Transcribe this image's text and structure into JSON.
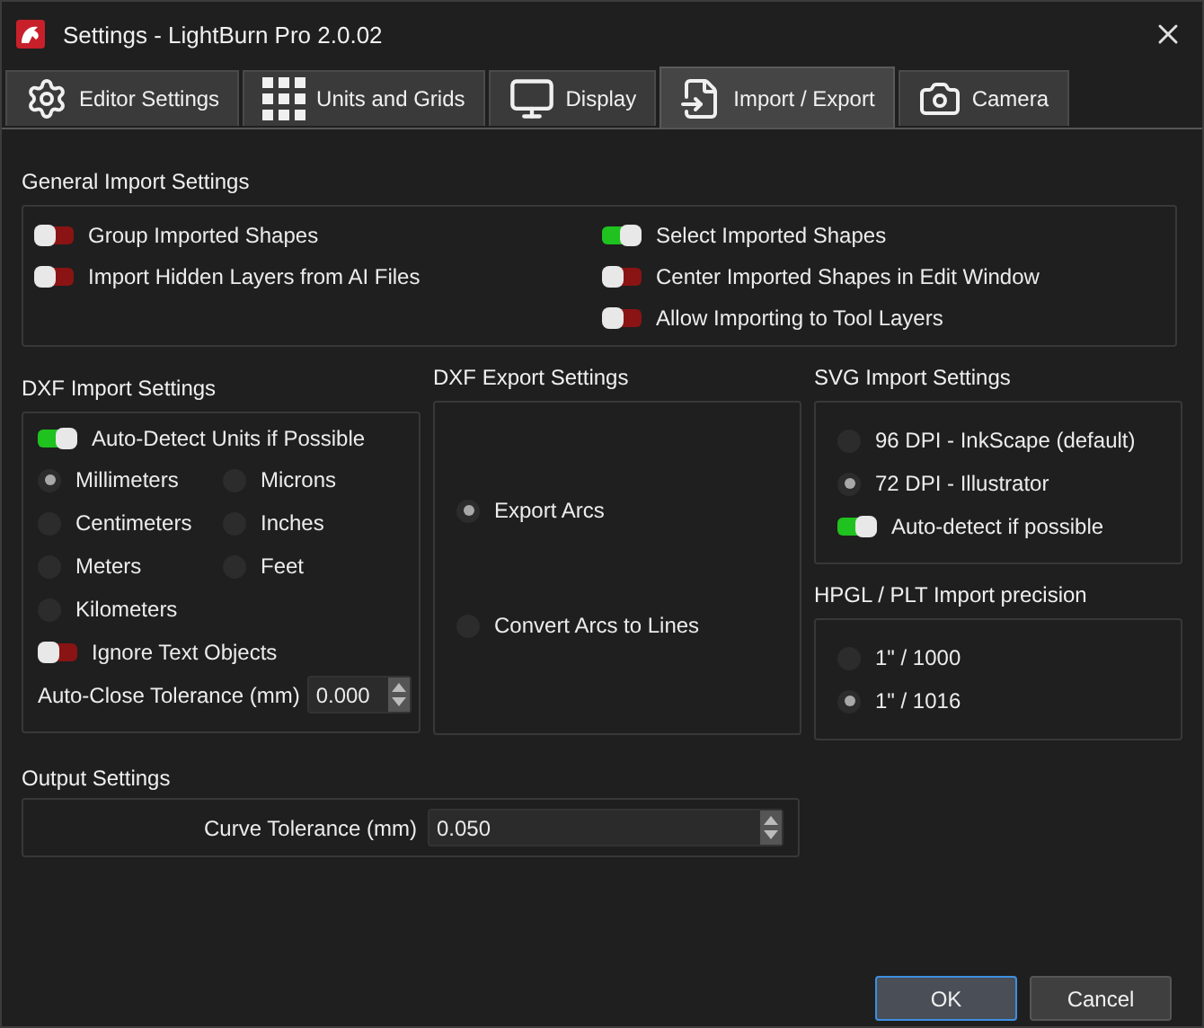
{
  "window": {
    "title": "Settings - LightBurn Pro 2.0.02"
  },
  "tabs": [
    {
      "label": "Editor Settings",
      "selected": false
    },
    {
      "label": "Units and Grids",
      "selected": false
    },
    {
      "label": "Display",
      "selected": false
    },
    {
      "label": "Import / Export",
      "selected": true
    },
    {
      "label": "Camera",
      "selected": false
    }
  ],
  "general_import": {
    "title": "General Import Settings",
    "left": [
      {
        "label": "Group Imported Shapes",
        "on": false
      },
      {
        "label": "Import Hidden Layers from AI Files",
        "on": false
      }
    ],
    "right": [
      {
        "label": "Select Imported Shapes",
        "on": true
      },
      {
        "label": "Center Imported Shapes in Edit Window",
        "on": false
      },
      {
        "label": "Allow Importing to Tool Layers",
        "on": false
      }
    ]
  },
  "dxf_import": {
    "title": "DXF Import Settings",
    "auto_detect": {
      "label": "Auto-Detect Units if Possible",
      "on": true
    },
    "units": [
      {
        "label": "Millimeters",
        "selected": true
      },
      {
        "label": "Microns",
        "selected": false
      },
      {
        "label": "Centimeters",
        "selected": false
      },
      {
        "label": "Inches",
        "selected": false
      },
      {
        "label": "Meters",
        "selected": false
      },
      {
        "label": "Feet",
        "selected": false
      },
      {
        "label": "Kilometers",
        "selected": false
      }
    ],
    "ignore_text": {
      "label": "Ignore Text Objects",
      "on": false
    },
    "tolerance": {
      "label": "Auto-Close Tolerance (mm)",
      "value": "0.000"
    }
  },
  "dxf_export": {
    "title": "DXF Export Settings",
    "options": [
      {
        "label": "Export Arcs",
        "selected": true
      },
      {
        "label": "Convert Arcs to Lines",
        "selected": false
      }
    ]
  },
  "svg_import": {
    "title": "SVG Import Settings",
    "options": [
      {
        "label": "96 DPI - InkScape (default)",
        "selected": false
      },
      {
        "label": "72 DPI - Illustrator",
        "selected": true
      }
    ],
    "auto_detect": {
      "label": "Auto-detect if possible",
      "on": true
    }
  },
  "hpgl_import": {
    "title": "HPGL / PLT Import precision",
    "options": [
      {
        "label": "1\" / 1000",
        "selected": false
      },
      {
        "label": "1\" / 1016",
        "selected": true
      }
    ]
  },
  "output": {
    "title": "Output Settings",
    "curve_tolerance": {
      "label": "Curve Tolerance (mm)",
      "value": "0.050"
    }
  },
  "buttons": [
    {
      "label": "OK",
      "default": true
    },
    {
      "label": "Cancel",
      "default": false
    }
  ]
}
